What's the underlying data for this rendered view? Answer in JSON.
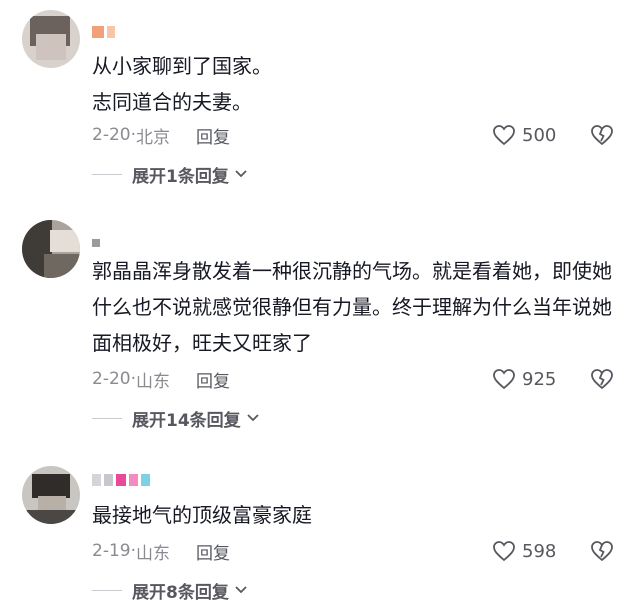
{
  "comments": [
    {
      "text": "从小家聊到了国家。\n志同道合的夫妻。",
      "date": "2-20",
      "location": "北京",
      "reply_label": "回复",
      "likes": "500",
      "expand_label": "展开1条回复",
      "like_icon": "heart-outline-icon",
      "dislike_icon": "broken-heart-icon"
    },
    {
      "text": "郭晶晶浑身散发着一种很沉静的气场。就是看着她，即使她什么也不说就感觉很静但有力量。终于理解为什么当年说她面相极好，旺夫又旺家了",
      "date": "2-20",
      "location": "山东",
      "reply_label": "回复",
      "likes": "925",
      "expand_label": "展开14条回复"
    },
    {
      "text": "最接地气的顶级富豪家庭",
      "date": "2-19",
      "location": "山东",
      "reply_label": "回复",
      "likes": "598",
      "expand_label": "展开8条回复"
    }
  ],
  "separator": "·",
  "colors": {
    "text": "#161823",
    "meta": "#8a8b91",
    "action": "#57585f"
  }
}
